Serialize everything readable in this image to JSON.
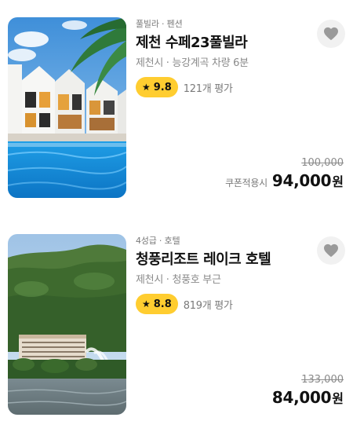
{
  "listings": [
    {
      "category": "풀빌라 · 펜션",
      "name": "제천 수페23풀빌라",
      "location": "제천시 · 능강계곡 차량 6분",
      "rating": "9.8",
      "reviews": "121개 평가",
      "original_price": "100,000",
      "coupon_label": "쿠폰적용시",
      "price": "94,000",
      "currency": "원",
      "image_icon": "poolvilla-photo"
    },
    {
      "category": "4성급 · 호텔",
      "name": "청풍리조트 레이크 호텔",
      "location": "제천시 · 청풍호 부근",
      "rating": "8.8",
      "reviews": "819개 평가",
      "original_price": "133,000",
      "price": "84,000",
      "currency": "원",
      "image_icon": "lake-hotel-photo"
    }
  ],
  "icons": {
    "star": "★",
    "wishlist": "heart-icon"
  },
  "colors": {
    "rating_badge": "#ffcd30",
    "wish_bg": "#f1f1f1",
    "heart": "#9a9a9a"
  }
}
